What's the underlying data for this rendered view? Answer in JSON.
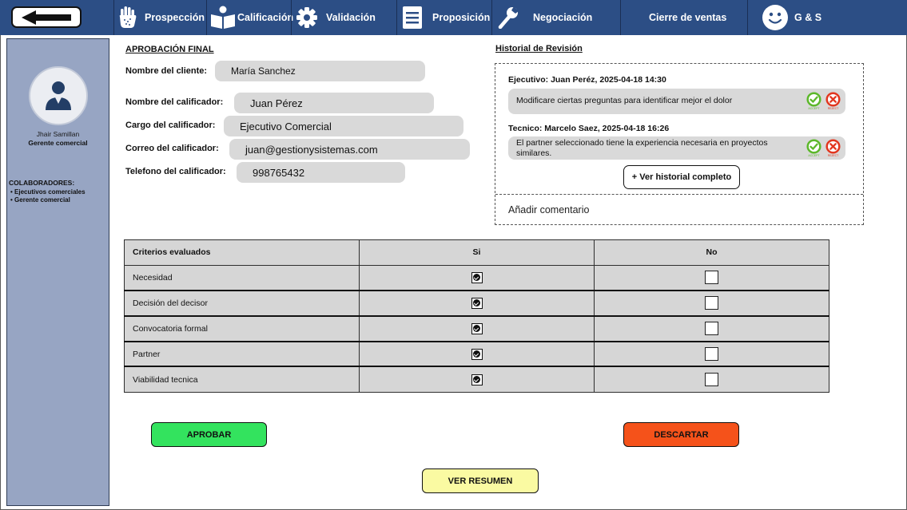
{
  "colors": {
    "nav_bg": "#2c4e85",
    "sidebar_bg": "#97a5c3",
    "field_bg": "#d9d9d9",
    "approve": "#33e35e",
    "discard": "#f5521a",
    "summary": "#fafaa2",
    "accept_icon": "#5cb82a",
    "reject_icon": "#e2361f"
  },
  "nav": {
    "back_icon": "arrow-left-icon",
    "items": [
      {
        "label": "Prospección",
        "icon": "hand-icon"
      },
      {
        "label": "Calificación",
        "icon": "book-reader-icon"
      },
      {
        "label": "Validación",
        "icon": "gear-icon"
      },
      {
        "label": "Proposición",
        "icon": "document-icon"
      },
      {
        "label": "Negociación",
        "icon": "wrench-icon"
      },
      {
        "label": "Cierre de ventas",
        "icon": ""
      },
      {
        "label": "G & S",
        "icon": "smiley-icon"
      }
    ]
  },
  "sidebar": {
    "avatar_icon": "user-avatar-icon",
    "user_name": "Jhair Samillan",
    "user_role": "Gerente comercial",
    "collaborators_title": "COLABORADORES:",
    "collaborators": [
      "Ejecutivos comerciales",
      "Gerente comercial"
    ]
  },
  "approval": {
    "title": "APROBACIÓN FINAL",
    "fields": [
      {
        "label": "Nombre del cliente:",
        "value": "María Sanchez"
      },
      {
        "label": "Nombre del calificador:",
        "value": "Juan Pérez"
      },
      {
        "label": "Cargo del calificador:",
        "value": "Ejecutivo Comercial"
      },
      {
        "label": "Correo del calificador:",
        "value": "juan@gestionysistemas.com"
      },
      {
        "label": "Telefono del calificador:",
        "value": "998765432"
      }
    ]
  },
  "history": {
    "title": "Historial de Revisión",
    "entries": [
      {
        "author": "Ejecutivo: Juan Peréz, 2025-04-18  14:30",
        "comment": "Modificare ciertas preguntas para identificar mejor el dolor",
        "accept_label": "ACCEPT",
        "reject_label": "REJECT"
      },
      {
        "author": "Tecnico: Marcelo Saez, 2025-04-18  16:26",
        "comment": "El partner seleccionado tiene la experiencia necesaria en proyectos similares.",
        "accept_label": "ACCEPT",
        "reject_label": "REJECT"
      }
    ],
    "view_all_label": "+ Ver historial completo",
    "add_comment_placeholder": "Añadir comentario"
  },
  "criteria_table": {
    "headers": [
      "Criterios evaluados",
      "Si",
      "No"
    ],
    "rows": [
      {
        "name": "Necesidad",
        "si": true,
        "no": false
      },
      {
        "name": "Decisión del decisor",
        "si": true,
        "no": false
      },
      {
        "name": "Convocatoria formal",
        "si": true,
        "no": false
      },
      {
        "name": "Partner",
        "si": true,
        "no": false
      },
      {
        "name": "Viabilidad tecnica",
        "si": true,
        "no": false
      }
    ]
  },
  "actions": {
    "approve_label": "APROBAR",
    "discard_label": "DESCARTAR",
    "summary_label": "VER RESUMEN"
  }
}
